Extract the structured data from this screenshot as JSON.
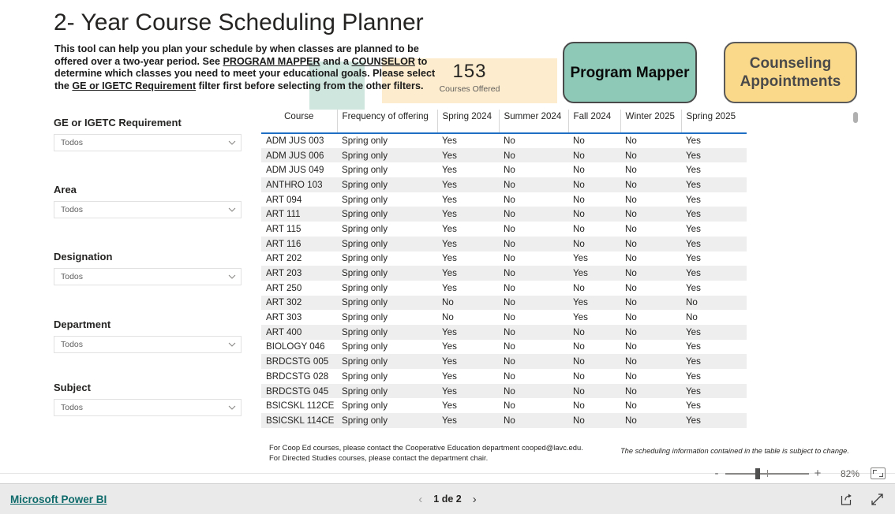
{
  "report": {
    "title": "2- Year Course Scheduling Planner",
    "intro": {
      "line1_a": "This tool can help you plan your schedule by when classes are planned to be offered over a two-year period. See ",
      "link_program_mapper": "PROGRAM MAPPER",
      "line1_b": " and a ",
      "link_counselor": "COUNSELOR",
      "line1_c": " to determine which classes you need to meet your educational goals. Please select the ",
      "link_ge_igetc": "GE or IGETC Requirement",
      "line1_d": " filter first before selecting from the other filters."
    }
  },
  "kpi": {
    "value": "153",
    "label": "Courses Offered"
  },
  "buttons": {
    "program_mapper": "Program Mapper",
    "counseling": "Counseling Appointments",
    "program_mapper_color": "#8ec9b7",
    "counseling_color": "#fbd98a"
  },
  "filters": [
    {
      "label": "GE or IGETC Requirement",
      "value": "Todos"
    },
    {
      "label": "Area",
      "value": "Todos"
    },
    {
      "label": "Designation",
      "value": "Todos"
    },
    {
      "label": "Department",
      "value": "Todos"
    },
    {
      "label": "Subject",
      "value": "Todos"
    }
  ],
  "table": {
    "columns": [
      "Course",
      "Frequency of offering",
      "Spring 2024",
      "Summer 2024",
      "Fall 2024",
      "Winter 2025",
      "Spring 2025"
    ],
    "sorted_column_index": 1,
    "sort_direction": "desc",
    "rows": [
      [
        "ADM JUS 003",
        "Spring only",
        "Yes",
        "No",
        "No",
        "No",
        "Yes"
      ],
      [
        "ADM JUS 006",
        "Spring only",
        "Yes",
        "No",
        "No",
        "No",
        "Yes"
      ],
      [
        "ADM JUS 049",
        "Spring only",
        "Yes",
        "No",
        "No",
        "No",
        "Yes"
      ],
      [
        "ANTHRO 103",
        "Spring only",
        "Yes",
        "No",
        "No",
        "No",
        "Yes"
      ],
      [
        "ART 094",
        "Spring only",
        "Yes",
        "No",
        "No",
        "No",
        "Yes"
      ],
      [
        "ART 111",
        "Spring only",
        "Yes",
        "No",
        "No",
        "No",
        "Yes"
      ],
      [
        "ART 115",
        "Spring only",
        "Yes",
        "No",
        "No",
        "No",
        "Yes"
      ],
      [
        "ART 116",
        "Spring only",
        "Yes",
        "No",
        "No",
        "No",
        "Yes"
      ],
      [
        "ART 202",
        "Spring only",
        "Yes",
        "No",
        "Yes",
        "No",
        "Yes"
      ],
      [
        "ART 203",
        "Spring only",
        "Yes",
        "No",
        "Yes",
        "No",
        "Yes"
      ],
      [
        "ART 250",
        "Spring only",
        "Yes",
        "No",
        "No",
        "No",
        "Yes"
      ],
      [
        "ART 302",
        "Spring only",
        "No",
        "No",
        "Yes",
        "No",
        "No"
      ],
      [
        "ART 303",
        "Spring only",
        "No",
        "No",
        "Yes",
        "No",
        "No"
      ],
      [
        "ART 400",
        "Spring only",
        "Yes",
        "No",
        "No",
        "No",
        "Yes"
      ],
      [
        "BIOLOGY 046",
        "Spring only",
        "Yes",
        "No",
        "No",
        "No",
        "Yes"
      ],
      [
        "BRDCSTG 005",
        "Spring only",
        "Yes",
        "No",
        "No",
        "No",
        "Yes"
      ],
      [
        "BRDCSTG 028",
        "Spring only",
        "Yes",
        "No",
        "No",
        "No",
        "Yes"
      ],
      [
        "BRDCSTG 045",
        "Spring only",
        "Yes",
        "No",
        "No",
        "No",
        "Yes"
      ],
      [
        "BSICSKL 112CE",
        "Spring only",
        "Yes",
        "No",
        "No",
        "No",
        "Yes"
      ],
      [
        "BSICSKL 114CE",
        "Spring only",
        "Yes",
        "No",
        "No",
        "No",
        "Yes"
      ]
    ]
  },
  "footnotes": {
    "left_line1": "For Coop Ed courses, please contact the Cooperative Education department  cooped@lavc.edu.",
    "left_line2": "For Directed Studies courses, please contact the department chair.",
    "right": "The scheduling information contained in the table is subject to change."
  },
  "zoom_control": {
    "minus": "-",
    "plus": "+",
    "percent": "82%"
  },
  "bottom_bar": {
    "brand": "Microsoft Power BI",
    "page_label": "1 de 2",
    "prev": "‹",
    "next": "›"
  }
}
